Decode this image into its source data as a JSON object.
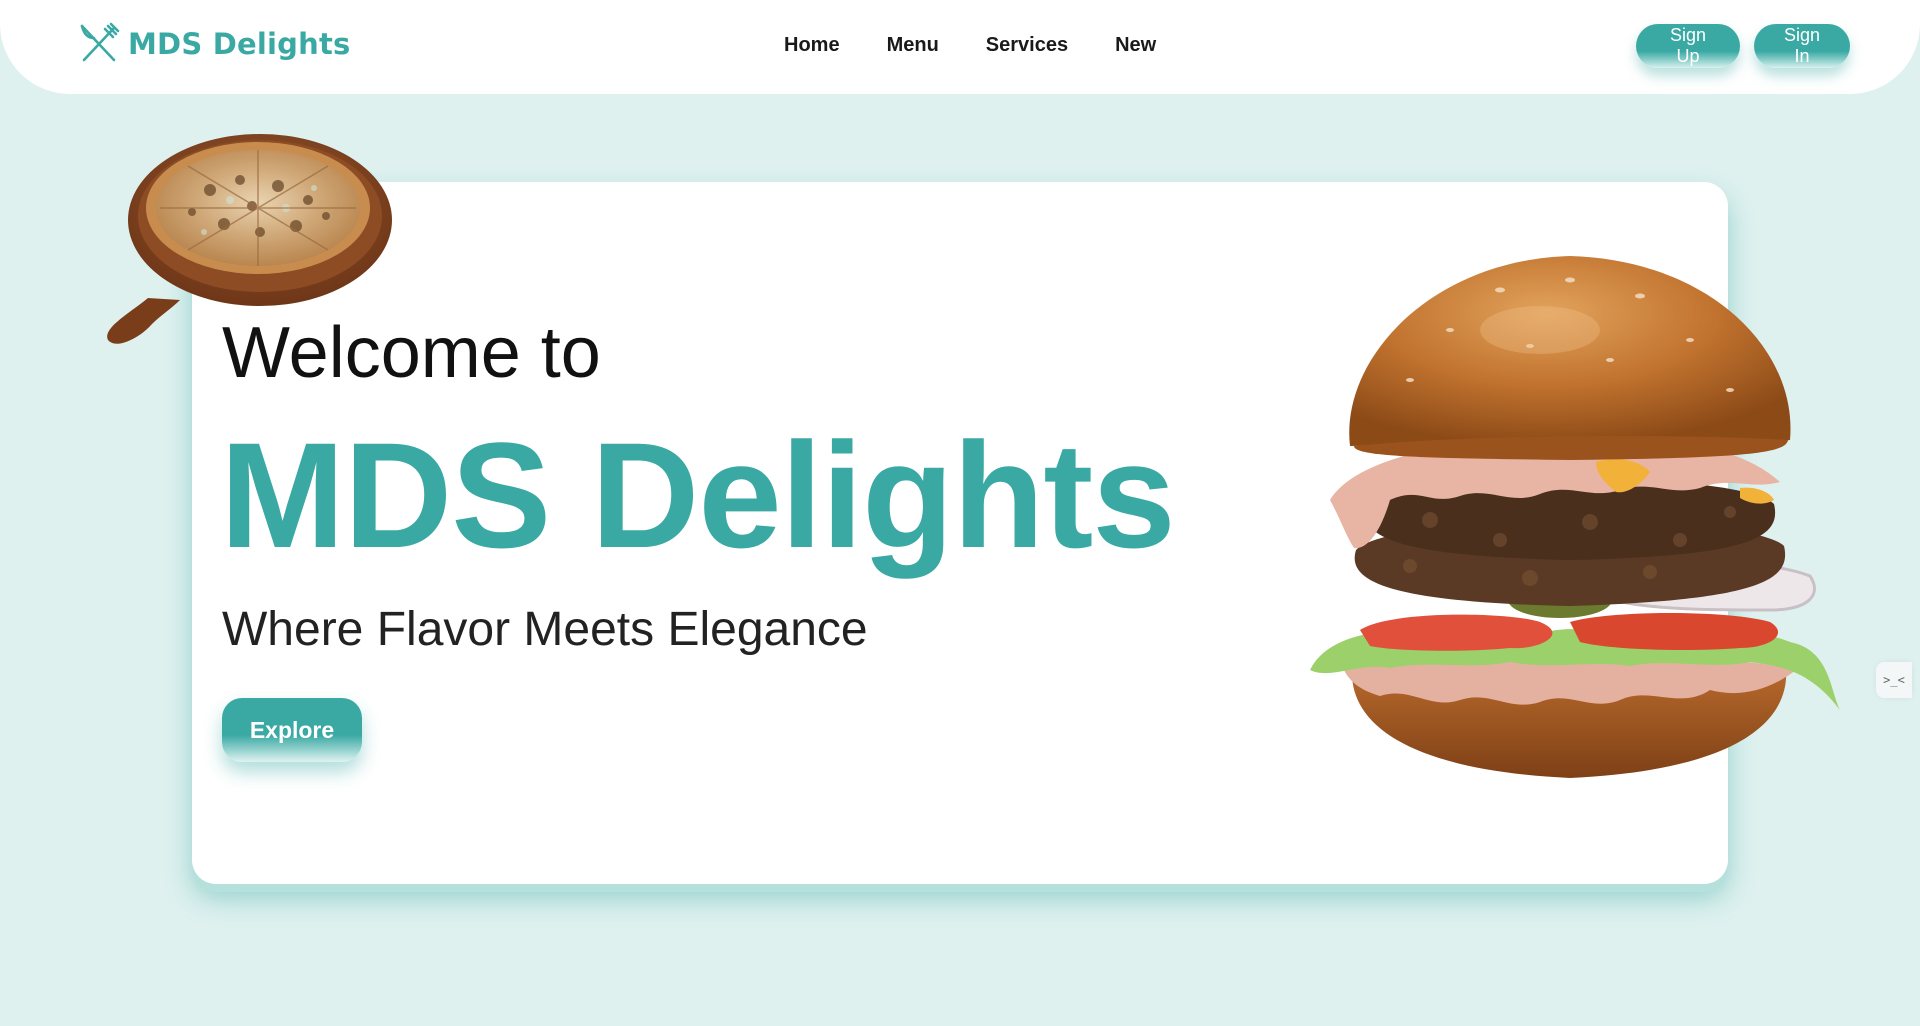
{
  "header": {
    "logo": {
      "text": "MDS Delights",
      "icon": "fork-knife-icon"
    },
    "nav": [
      {
        "label": "Home"
      },
      {
        "label": "Menu"
      },
      {
        "label": "Services"
      },
      {
        "label": "New"
      }
    ],
    "auth": {
      "signup_label": "Sign Up",
      "signin_label": "Sign In"
    }
  },
  "hero": {
    "welcome": "Welcome to",
    "title": "MDS Delights",
    "tagline": "Where Flavor Meets Elegance",
    "cta_label": "Explore",
    "images": {
      "pizza": "pizza-image",
      "burger": "burger-image"
    }
  },
  "side_toggle": {
    "label": ">_<"
  },
  "colors": {
    "accent": "#3aa9a4",
    "background": "#def1ef",
    "card": "#ffffff",
    "text_dark": "#111111"
  }
}
